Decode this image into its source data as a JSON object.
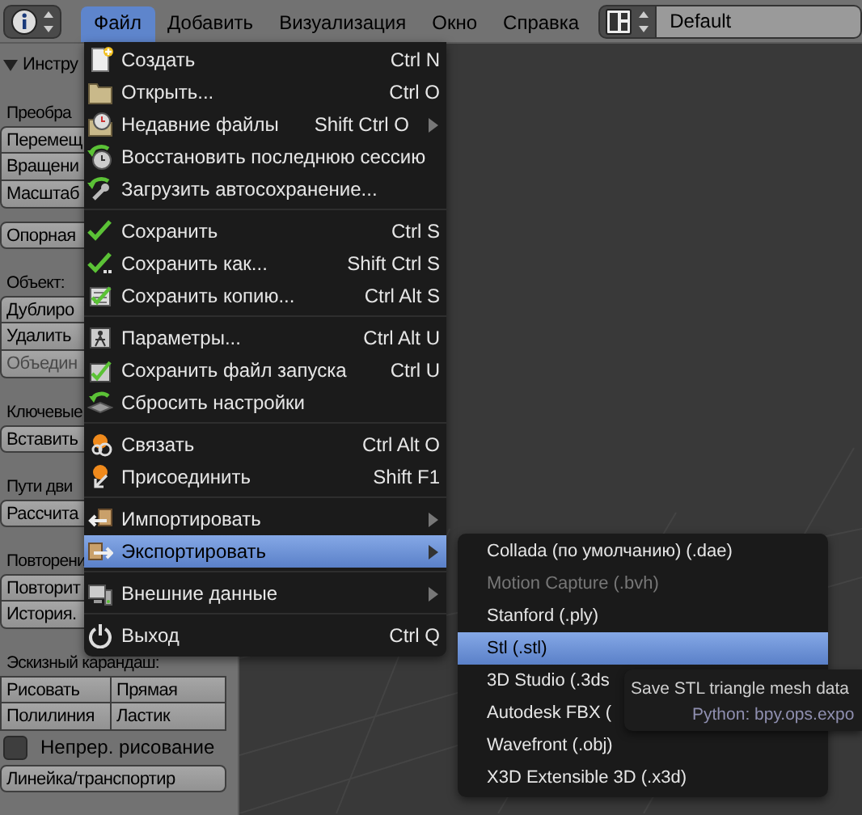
{
  "topbar": {
    "menus": [
      {
        "label": "Файл",
        "selected": true
      },
      {
        "label": "Добавить",
        "selected": false
      },
      {
        "label": "Визуализация",
        "selected": false
      },
      {
        "label": "Окно",
        "selected": false
      },
      {
        "label": "Справка",
        "selected": false
      }
    ],
    "layout_field": "Default"
  },
  "tool_panel": {
    "header": "Инстру",
    "expanded": true,
    "items": [
      {
        "kind": "label",
        "text": "Преобра"
      },
      {
        "kind": "column",
        "buttons": [
          {
            "label": "Перемещ",
            "disabled": false
          },
          {
            "label": "Вращени",
            "disabled": false
          },
          {
            "label": "Масштаб",
            "disabled": false
          }
        ]
      },
      {
        "kind": "column",
        "buttons": [
          {
            "label": "Опорная",
            "disabled": false
          }
        ]
      },
      {
        "kind": "label",
        "text": "Объект:"
      },
      {
        "kind": "column",
        "buttons": [
          {
            "label": "Дублиро",
            "disabled": false
          },
          {
            "label": "Удалить",
            "disabled": false
          },
          {
            "label": "Объедин",
            "disabled": true
          }
        ]
      },
      {
        "kind": "label",
        "text": "Ключевые"
      },
      {
        "kind": "column",
        "buttons": [
          {
            "label": "Вставить",
            "disabled": false
          }
        ]
      },
      {
        "kind": "label",
        "text": "Пути дви"
      },
      {
        "kind": "column",
        "buttons": [
          {
            "label": "Рассчита",
            "disabled": false
          }
        ]
      },
      {
        "kind": "label",
        "text": "Повторени"
      },
      {
        "kind": "column",
        "buttons": [
          {
            "label": "Повторит",
            "disabled": false
          },
          {
            "label": "История.",
            "disabled": false
          }
        ]
      },
      {
        "kind": "label",
        "text": "Эскизный карандаш:"
      },
      {
        "kind": "grid",
        "rows": [
          [
            {
              "label": "Рисовать",
              "disabled": false
            },
            {
              "label": "Прямая",
              "disabled": false
            }
          ],
          [
            {
              "label": "Полилиния",
              "disabled": false
            },
            {
              "label": "Ластик",
              "disabled": false
            }
          ]
        ]
      },
      {
        "kind": "checkbox",
        "text": "Непрер. рисование",
        "checked": false
      },
      {
        "kind": "column",
        "buttons": [
          {
            "label": "Линейка/транспортир",
            "disabled": false
          }
        ]
      }
    ]
  },
  "file_menu": {
    "groups": [
      [
        {
          "label": "Создать",
          "shortcut": "Ctrl N",
          "submenu": false,
          "selected": false
        },
        {
          "label": "Открыть...",
          "shortcut": "Ctrl O",
          "submenu": false,
          "selected": false
        },
        {
          "label": "Недавние файлы",
          "shortcut": "Shift Ctrl O",
          "submenu": true,
          "selected": false
        },
        {
          "label": "Восстановить последнюю сессию",
          "submenu": false,
          "selected": false
        },
        {
          "label": "Загрузить автосохранение...",
          "submenu": false,
          "selected": false
        }
      ],
      [
        {
          "label": "Сохранить",
          "shortcut": "Ctrl S",
          "submenu": false,
          "selected": false
        },
        {
          "label": "Сохранить как...",
          "shortcut": "Shift Ctrl S",
          "submenu": false,
          "selected": false
        },
        {
          "label": "Сохранить копию...",
          "shortcut": "Ctrl Alt S",
          "submenu": false,
          "selected": false
        }
      ],
      [
        {
          "label": "Параметры...",
          "shortcut": "Ctrl Alt U",
          "submenu": false,
          "selected": false
        },
        {
          "label": "Сохранить файл запуска",
          "shortcut": "Ctrl U",
          "submenu": false,
          "selected": false
        },
        {
          "label": "Сбросить настройки",
          "submenu": false,
          "selected": false
        }
      ],
      [
        {
          "label": "Связать",
          "shortcut": "Ctrl Alt O",
          "submenu": false,
          "selected": false
        },
        {
          "label": "Присоединить",
          "shortcut": "Shift F1",
          "submenu": false,
          "selected": false
        }
      ],
      [
        {
          "label": "Импортировать",
          "submenu": true,
          "selected": false
        },
        {
          "label": "Экспортировать",
          "submenu": true,
          "selected": true
        }
      ],
      [
        {
          "label": "Внешние данные",
          "submenu": true,
          "selected": false
        }
      ],
      [
        {
          "label": "Выход",
          "shortcut": "Ctrl Q",
          "submenu": false,
          "selected": false
        }
      ]
    ]
  },
  "export_submenu": {
    "items": [
      {
        "label": "Collada (по умолчанию) (.dae)",
        "disabled": false,
        "selected": false
      },
      {
        "label": "Motion Capture (.bvh)",
        "disabled": true,
        "selected": false
      },
      {
        "label": "Stanford (.ply)",
        "disabled": false,
        "selected": false
      },
      {
        "label": "Stl (.stl)",
        "disabled": false,
        "selected": true
      },
      {
        "label": "3D Studio (.3ds",
        "disabled": false,
        "selected": false
      },
      {
        "label": "Autodesk FBX (",
        "disabled": false,
        "selected": false
      },
      {
        "label": "Wavefront (.obj)",
        "disabled": false,
        "selected": false
      },
      {
        "label": "X3D Extensible 3D (.x3d)",
        "disabled": false,
        "selected": false
      }
    ]
  },
  "tooltip": {
    "description": "Save STL triangle mesh data",
    "python": "Python: bpy.ops.expo"
  }
}
